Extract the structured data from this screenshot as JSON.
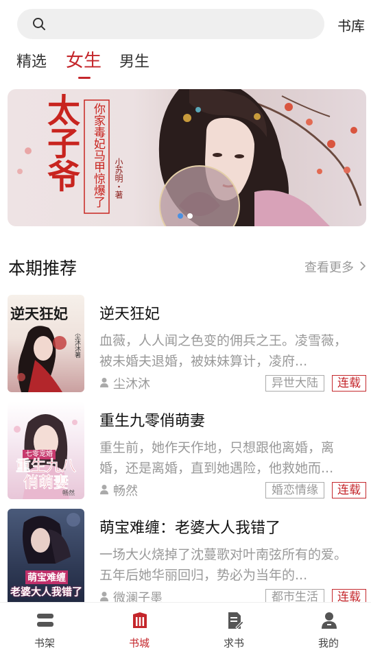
{
  "search": {
    "placeholder": ""
  },
  "header": {
    "library_label": "书库"
  },
  "tabs": [
    {
      "label": "精选"
    },
    {
      "label": "女生"
    },
    {
      "label": "男生"
    }
  ],
  "banner": {
    "title": "太子爷",
    "subtitle": "你家毒妃马甲惊爆了",
    "author": "小苏明・著",
    "page_count": 2,
    "active_page": 1,
    "colors": {
      "title": "#c8241f",
      "dot_active": "#4a90e2",
      "dot_inactive": "#ffffff"
    }
  },
  "section": {
    "title": "本期推荐",
    "more_label": "查看更多"
  },
  "books": [
    {
      "title": "逆天狂妃",
      "desc": "血薇，人人闻之色变的佣兵之王。凌雪薇，被未婚夫退婚，被妹妹算计，凌府...",
      "author": "尘沐沐",
      "genre": "异世大陆",
      "status": "连载",
      "cover_title": "逆天狂妃",
      "cover_author": "尘沐沐著"
    },
    {
      "title": "重生九零俏萌妻",
      "desc": "重生前，她作天作地，只想跟他离婚，离婚，还是离婚，直到她遇险，他救她而...",
      "author": "畅然",
      "genre": "婚恋情缘",
      "status": "连载",
      "cover_title": "重生九八俏萌妻",
      "cover_badge": "七零宠婚",
      "cover_author": "畅然"
    },
    {
      "title": "萌宝难缠：老婆大人我错了",
      "desc": "一场大火烧掉了沈蔓歌对叶南弦所有的爱。五年后她华丽回归，势必为当年的...",
      "author": "微澜子墨",
      "genre": "都市生活",
      "status": "连载",
      "cover_title": "萌宝难缠",
      "cover_subtitle": "老婆大人我错了"
    }
  ],
  "tabbar": [
    {
      "label": "书架",
      "icon": "bookshelf-icon"
    },
    {
      "label": "书城",
      "icon": "bookstore-icon"
    },
    {
      "label": "求书",
      "icon": "request-book-icon"
    },
    {
      "label": "我的",
      "icon": "profile-icon"
    }
  ],
  "colors": {
    "accent": "#c4262b",
    "muted": "#999999",
    "search_bg": "#efefef"
  }
}
